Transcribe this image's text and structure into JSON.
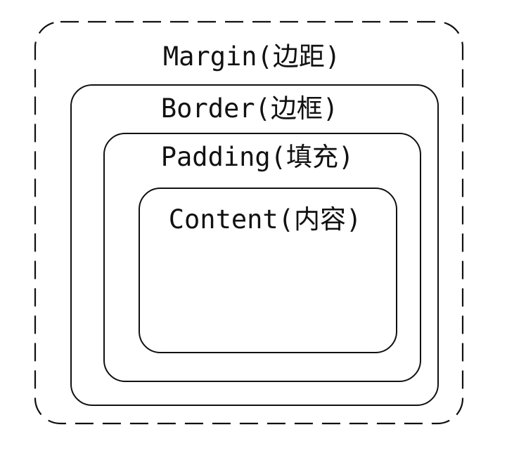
{
  "diagram": {
    "layers": [
      {
        "id": "margin",
        "label": "Margin(边距)",
        "line_style": "dashed"
      },
      {
        "id": "border",
        "label": "Border(边框)",
        "line_style": "solid"
      },
      {
        "id": "padding",
        "label": "Padding(填充)",
        "line_style": "solid"
      },
      {
        "id": "content",
        "label": "Content(内容)",
        "line_style": "solid"
      }
    ]
  }
}
